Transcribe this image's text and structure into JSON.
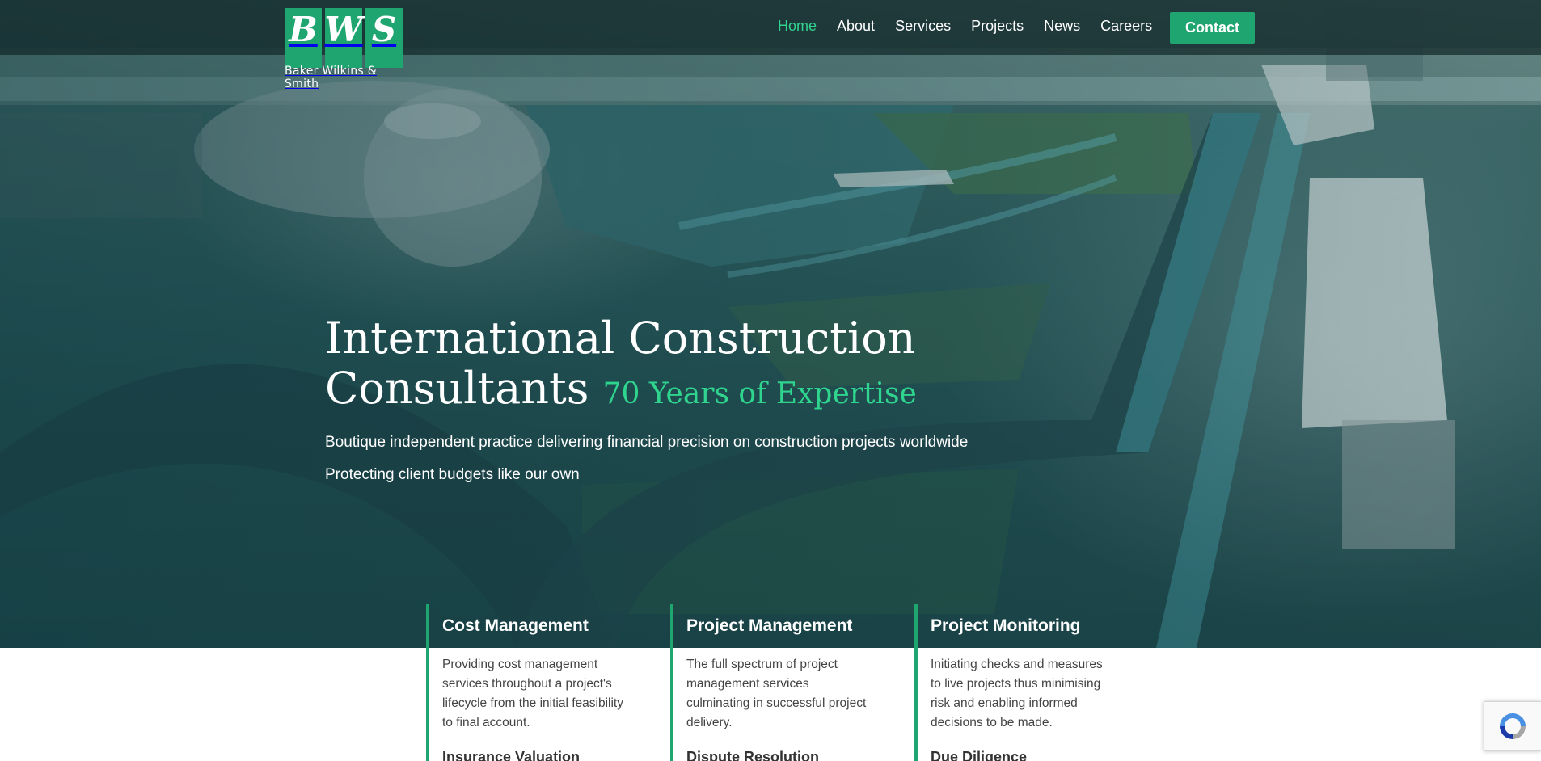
{
  "brand": {
    "logo_letters": [
      "B",
      "W",
      "S"
    ],
    "name": "Baker Wilkins & Smith",
    "accent_color": "#1fa56f",
    "highlight_color": "#2fd48f"
  },
  "nav": {
    "items": [
      {
        "label": "Home",
        "active": true
      },
      {
        "label": "About"
      },
      {
        "label": "Services"
      },
      {
        "label": "Projects"
      },
      {
        "label": "News"
      },
      {
        "label": "Careers"
      }
    ],
    "contact_label": "Contact"
  },
  "hero": {
    "headline_line1": "International Construction",
    "headline_line2": "Consultants",
    "headline_accent": "70 Years of Expertise",
    "subtitle_1": "Boutique independent practice delivering financial precision on construction projects worldwide",
    "subtitle_2": "Protecting client budgets like our own"
  },
  "services": [
    {
      "title": "Cost Management",
      "description": "Providing cost management services throughout a project's lifecycle from the initial feasibility to final account.",
      "next_heading": "Insurance Valuation"
    },
    {
      "title": "Project Management",
      "description": "The full spectrum of project management services culminating in successful project delivery.",
      "next_heading": "Dispute Resolution"
    },
    {
      "title": "Project Monitoring",
      "description": "Initiating checks and measures to live projects thus minimising risk and enabling informed decisions to be made.",
      "next_heading": "Due Diligence"
    }
  ],
  "recaptcha": {
    "icon": "recaptcha-icon"
  }
}
